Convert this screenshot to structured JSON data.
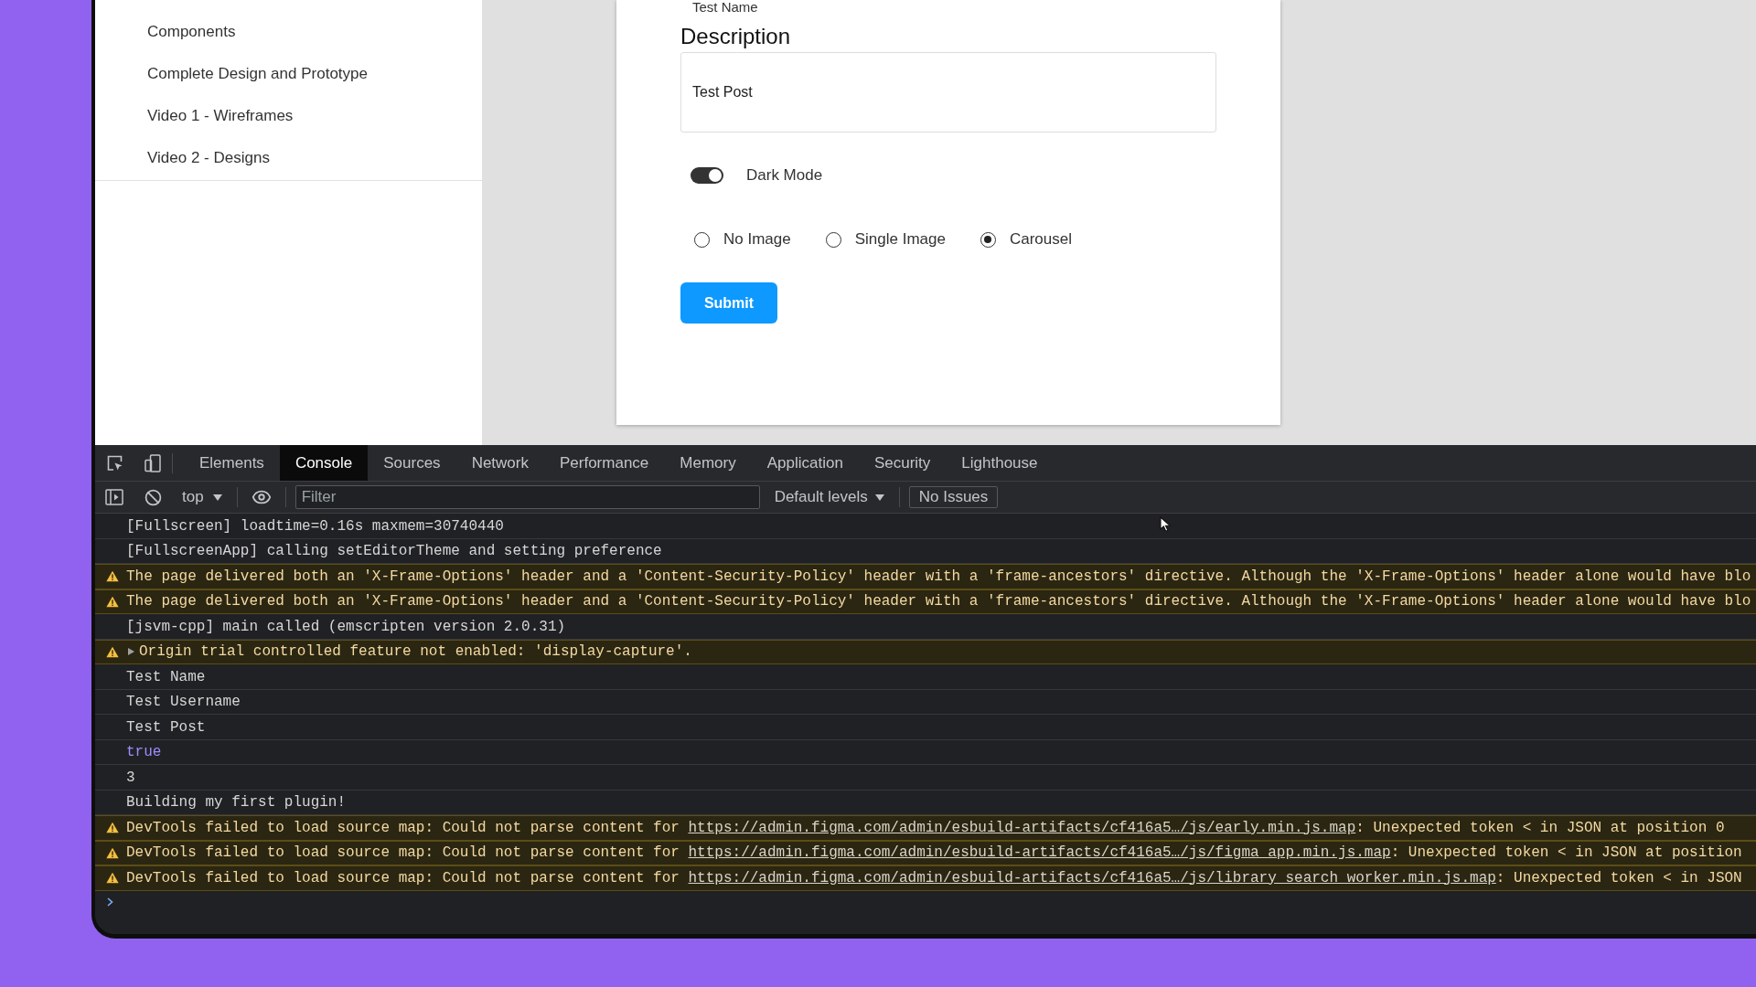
{
  "sidebar": {
    "items": [
      "Components",
      "Complete Design and Prototype",
      "Video 1 - Wireframes",
      "Video 2 - Designs"
    ]
  },
  "form": {
    "name_value": "Test Name",
    "description": {
      "label": "Description",
      "value": "Test Post"
    },
    "toggle": {
      "label": "Dark Mode",
      "on": true
    },
    "image_options": [
      {
        "label": "No Image",
        "selected": false
      },
      {
        "label": "Single Image",
        "selected": false
      },
      {
        "label": "Carousel",
        "selected": true
      }
    ],
    "submit": "Submit"
  },
  "devtools": {
    "tabs": [
      {
        "label": "Elements",
        "selected": false
      },
      {
        "label": "Console",
        "selected": true
      },
      {
        "label": "Sources",
        "selected": false
      },
      {
        "label": "Network",
        "selected": false
      },
      {
        "label": "Performance",
        "selected": false
      },
      {
        "label": "Memory",
        "selected": false
      },
      {
        "label": "Application",
        "selected": false
      },
      {
        "label": "Security",
        "selected": false
      },
      {
        "label": "Lighthouse",
        "selected": false
      }
    ],
    "console_toolbar": {
      "context": "top",
      "filter": {
        "placeholder": "Filter"
      },
      "levels": "Default levels",
      "issues": "No Issues"
    },
    "messages": [
      {
        "kind": "log",
        "text": "[Fullscreen] loadtime=0.16s maxmem=30740440"
      },
      {
        "kind": "log",
        "text": "[FullscreenApp] calling setEditorTheme and setting preference"
      },
      {
        "kind": "warning",
        "text": "The page delivered both an 'X-Frame-Options' header and a 'Content-Security-Policy' header with a 'frame-ancestors' directive. Although the 'X-Frame-Options' header alone would have blo"
      },
      {
        "kind": "warning",
        "text": "The page delivered both an 'X-Frame-Options' header and a 'Content-Security-Policy' header with a 'frame-ancestors' directive. Although the 'X-Frame-Options' header alone would have blo"
      },
      {
        "kind": "log",
        "text": "[jsvm-cpp] main called (emscripten version 2.0.31)"
      },
      {
        "kind": "warning",
        "expanded": false,
        "text": "Origin trial controlled feature not enabled: 'display-capture'."
      },
      {
        "kind": "log",
        "text": "Test Name"
      },
      {
        "kind": "log",
        "text": "Test Username"
      },
      {
        "kind": "log",
        "text": "Test Post"
      },
      {
        "kind": "value",
        "text": "true"
      },
      {
        "kind": "log",
        "text": "3"
      },
      {
        "kind": "log",
        "text": "Building my first plugin!"
      },
      {
        "kind": "warning",
        "text": "DevTools failed to load source map: Could not parse content for",
        "link": "https://admin.figma.com/admin/esbuild-artifacts/cf416a5…/js/early.min.js.map",
        "after": ": Unexpected token < in JSON at position 0"
      },
      {
        "kind": "warning",
        "text": "DevTools failed to load source map: Could not parse content for",
        "link": "https://admin.figma.com/admin/esbuild-artifacts/cf416a5…/js/figma_app.min.js.map",
        "after": ": Unexpected token < in JSON at position"
      },
      {
        "kind": "warning",
        "text": "DevTools failed to load source map: Could not parse content for",
        "link": "https://admin.figma.com/admin/esbuild-artifacts/cf416a5…/js/library_search_worker.min.js.map",
        "after": ": Unexpected token < in JSON"
      }
    ]
  }
}
